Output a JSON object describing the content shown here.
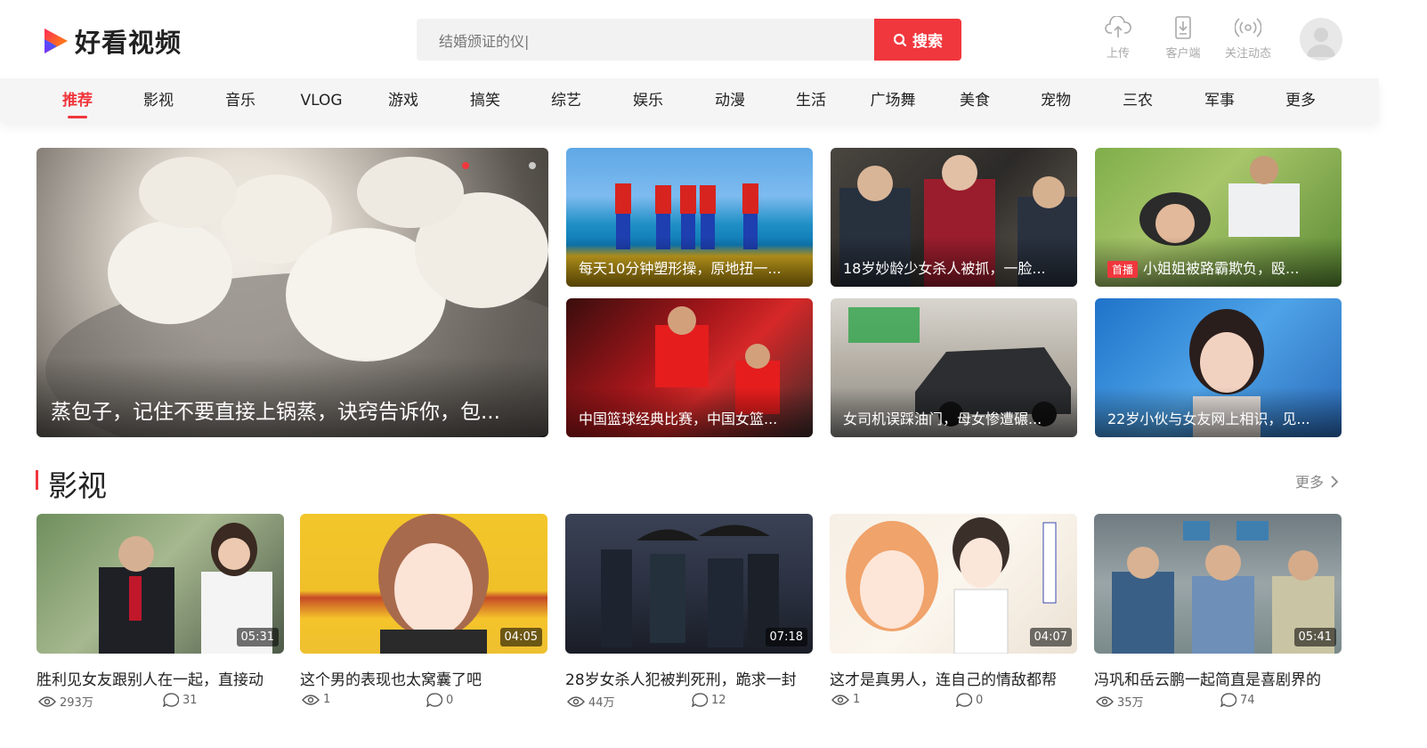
{
  "header": {
    "logo_text": "好看视频",
    "search": {
      "value": "结婚颁证的仪|",
      "button_label": "搜索"
    },
    "actions": [
      {
        "label": "上传",
        "icon": "cloud-upload-icon"
      },
      {
        "label": "客户端",
        "icon": "download-icon"
      },
      {
        "label": "关注动态",
        "icon": "broadcast-icon"
      }
    ]
  },
  "nav": {
    "items": [
      "推荐",
      "影视",
      "音乐",
      "VLOG",
      "游戏",
      "搞笑",
      "综艺",
      "娱乐",
      "动漫",
      "生活",
      "广场舞",
      "美食",
      "宠物",
      "三农",
      "军事",
      "更多"
    ],
    "active_index": 0
  },
  "hero": {
    "main": {
      "caption": "蒸包子，记住不要直接上锅蒸，诀窍告诉你，包..."
    },
    "tiles": [
      {
        "caption": "每天10分钟塑形操，原地扭一..."
      },
      {
        "caption": "18岁妙龄少女杀人被抓，一脸..."
      },
      {
        "badge": "首播",
        "caption": "小姐姐被路霸欺负，殴..."
      },
      {
        "caption": "中国篮球经典比赛，中国女篮..."
      },
      {
        "caption": "女司机误踩油门，母女惨遭碾..."
      },
      {
        "caption": "22岁小伙与女友网上相识，见..."
      }
    ]
  },
  "section": {
    "title": "影视",
    "more_label": "更多",
    "cards": [
      {
        "title": "胜利见女友跟别人在一起，直接动",
        "duration": "05:31",
        "views": "293万",
        "comments": "31"
      },
      {
        "title": "这个男的表现也太窝囊了吧",
        "duration": "04:05",
        "views": "1",
        "comments": "0"
      },
      {
        "title": "28岁女杀人犯被判死刑，跪求一封",
        "duration": "07:18",
        "views": "44万",
        "comments": "12"
      },
      {
        "title": "这才是真男人，连自己的情敌都帮",
        "duration": "04:07",
        "views": "1",
        "comments": "0"
      },
      {
        "title": "冯巩和岳云鹏一起简直是喜剧界的",
        "duration": "05:41",
        "views": "35万",
        "comments": "74"
      }
    ]
  },
  "colors": {
    "accent": "#f0373d",
    "nav_bg": "#f5f5f5",
    "search_bg": "#f2f2f2"
  }
}
